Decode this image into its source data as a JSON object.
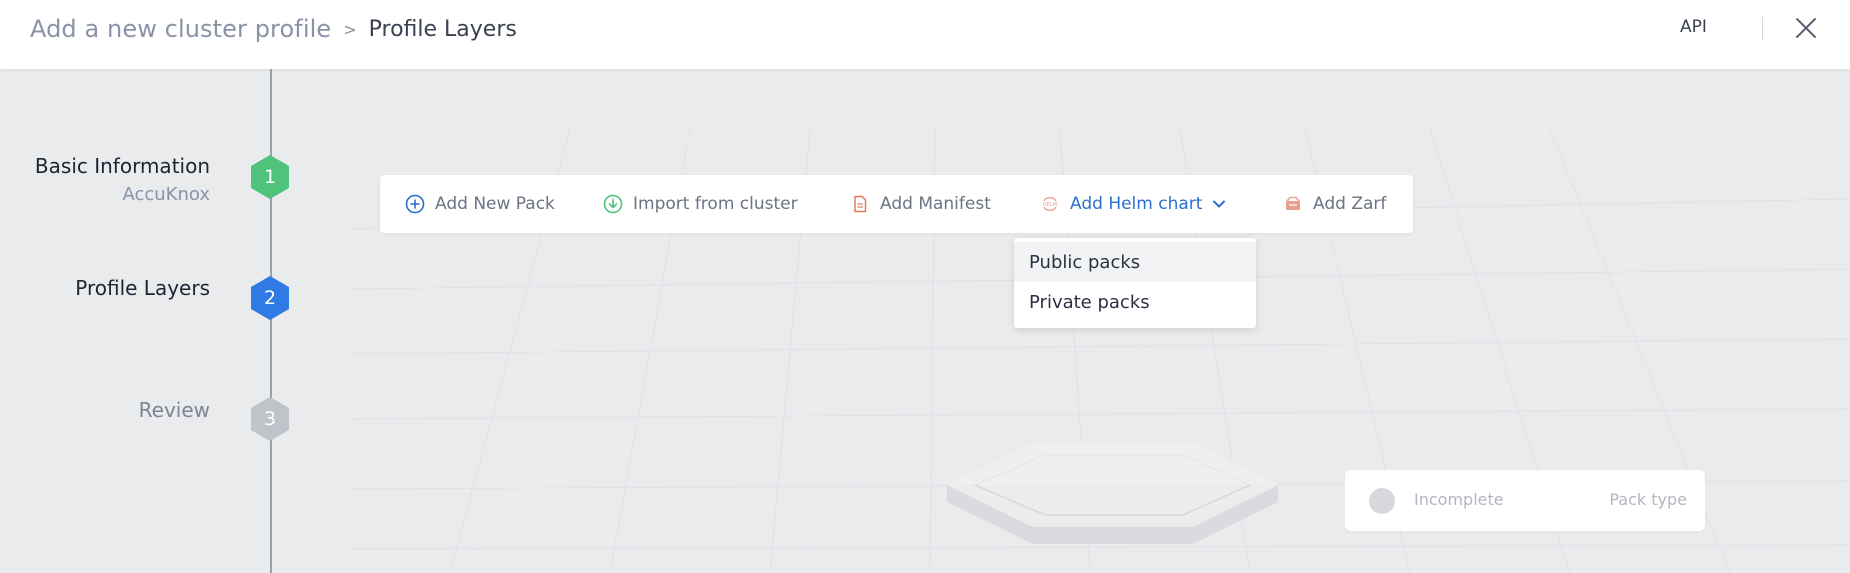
{
  "header": {
    "breadcrumb_root": "Add a new cluster profile",
    "breadcrumb_separator": ">",
    "breadcrumb_current": "Profile Layers",
    "api_label": "API"
  },
  "steps": [
    {
      "number": "1",
      "title": "Basic Information",
      "subtitle": "AccuKnox",
      "state": "completed",
      "color": "#4fc37c"
    },
    {
      "number": "2",
      "title": "Profile Layers",
      "state": "current",
      "color": "#2f7ae5"
    },
    {
      "number": "3",
      "title": "Review",
      "state": "pending",
      "color": "#bfc3ca"
    }
  ],
  "toolbar": {
    "items": [
      {
        "label": "Add New Pack",
        "icon": "plus-circle-icon"
      },
      {
        "label": "Import from cluster",
        "icon": "download-circle-icon"
      },
      {
        "label": "Add Manifest",
        "icon": "document-icon"
      },
      {
        "label": "Add Helm chart",
        "icon": "helm-icon",
        "active": true
      },
      {
        "label": "Add Zarf",
        "icon": "zarf-icon"
      }
    ]
  },
  "helm_dropdown": {
    "options": [
      "Public packs",
      "Private packs"
    ],
    "hovered": "Public packs"
  },
  "layer_card": {
    "status": "Incomplete",
    "type_label": "Pack type"
  },
  "colors": {
    "accent": "#2c6fd1",
    "completed": "#4fc37c",
    "pending": "#bfc3ca",
    "background": "#e9ebed"
  }
}
